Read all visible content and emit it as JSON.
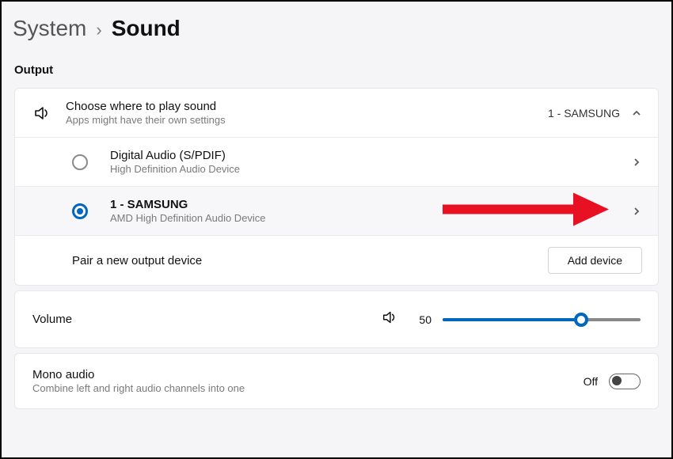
{
  "breadcrumb": {
    "parent": "System",
    "current": "Sound"
  },
  "output": {
    "section_label": "Output",
    "choose": {
      "title": "Choose where to play sound",
      "subtitle": "Apps might have their own settings",
      "current": "1 - SAMSUNG"
    },
    "devices": [
      {
        "name": "Digital Audio (S/PDIF)",
        "driver": "High Definition Audio Device",
        "selected": false
      },
      {
        "name": "1 - SAMSUNG",
        "driver": "AMD High Definition Audio Device",
        "selected": true
      }
    ],
    "pair": {
      "label": "Pair a new output device",
      "button": "Add device"
    }
  },
  "volume": {
    "label": "Volume",
    "value": "50",
    "percent": 70
  },
  "mono": {
    "title": "Mono audio",
    "subtitle": "Combine left and right audio channels into one",
    "state": "Off"
  }
}
